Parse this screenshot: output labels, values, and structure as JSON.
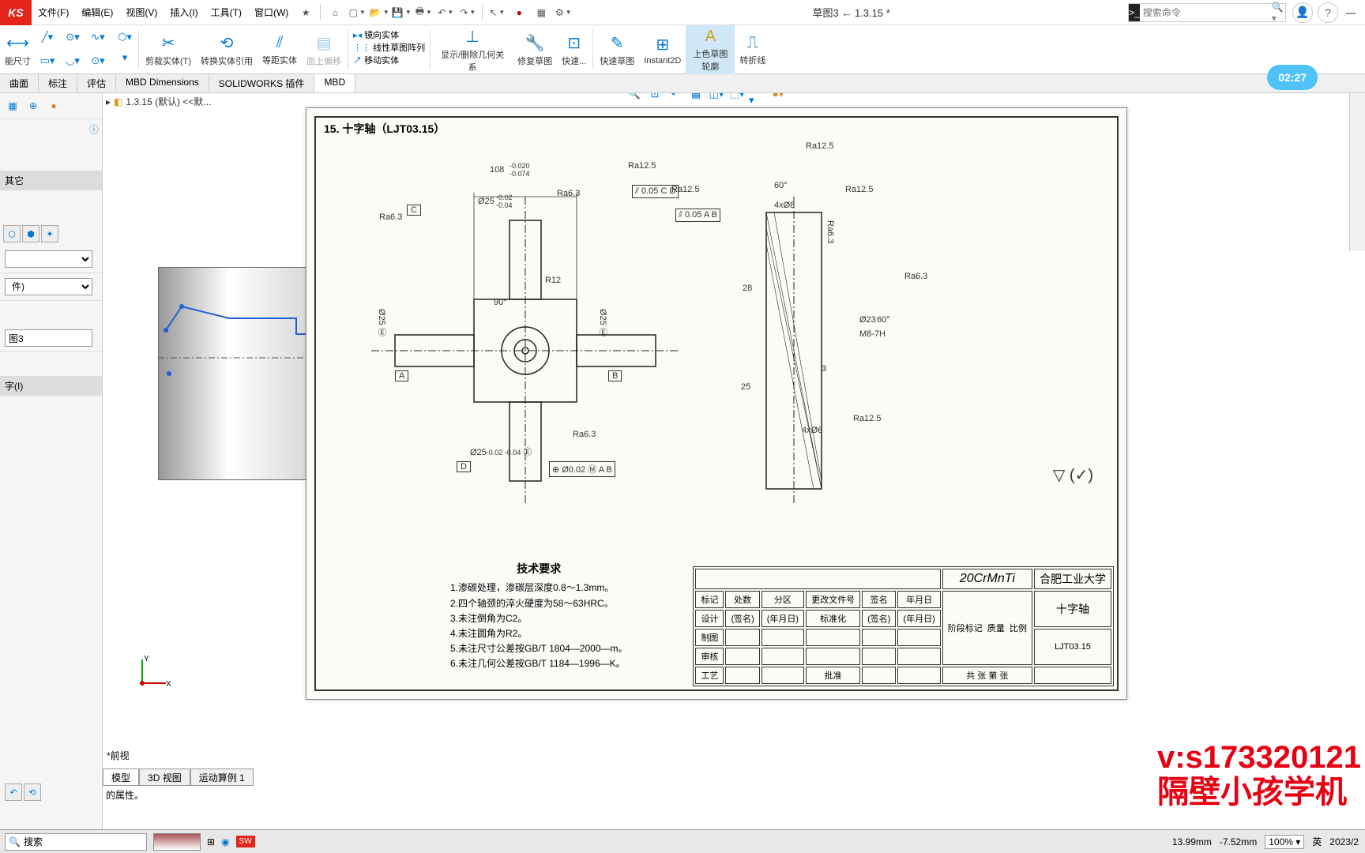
{
  "menubar": {
    "logo": "KS",
    "items": [
      "文件(F)",
      "编辑(E)",
      "视图(V)",
      "插入(I)",
      "工具(T)",
      "窗口(W)"
    ],
    "doc_title": "草图3 ← 1.3.15 *",
    "search_placeholder": "搜索命令"
  },
  "ribbon": {
    "btn1": "能尺寸",
    "trim": "剪裁实体(T)",
    "convert": "转换实体引用",
    "offset": "等距实体",
    "surface": "面上偏移",
    "mirror": "镜向实体",
    "pattern": "线性草图阵列",
    "move": "移动实体",
    "relations": "显示/删除几何关系",
    "repair": "修复草图",
    "quick1": "快速...",
    "quick2": "快速草图",
    "instant": "Instant2D",
    "shade": "上色草图轮廓",
    "snap": "转折线",
    "timer": "02:27"
  },
  "tabs": [
    "曲面",
    "标注",
    "评估",
    "MBD Dimensions",
    "SOLIDWORKS 插件",
    "MBD"
  ],
  "breadcrumb": "1.3.15 (默认) <<默...",
  "panel": {
    "section1": "其它",
    "input1": "图3",
    "section2": "字(I)",
    "dropdown1": "件)"
  },
  "view_label": "*前视",
  "drawing": {
    "title": "15. 十字轴（LJT03.15）",
    "tech_title": "技术要求",
    "tech": [
      "1.渗碳处理，渗碳层深度0.8～1.3mm。",
      "2.四个轴颈的淬火硬度为58～63HRC。",
      "3.未注倒角为C2。",
      "4.未注圆角为R2。",
      "5.未注尺寸公差按GB/T 1804—2000—m。",
      "6.未注几何公差按GB/T 1184—1996—K。"
    ],
    "dims": {
      "d108a": "108",
      "d108tol": "-0.020\n-0.074",
      "d25": "Ø25",
      "d25tol": "-0.02\n-0.04",
      "r12": "R12",
      "ang90": "90°",
      "ra63": "Ra6.3",
      "ra125": "Ra12.5",
      "fcf1": "0.05",
      "fcf2": "Ø0.02",
      "ang60": "60°",
      "d28": "28",
      "d25b": "25",
      "d3": "3",
      "dim4x08": "4xØ8",
      "dim4x06": "4xØ6",
      "d23": "Ø23",
      "m8": "M8-7H"
    },
    "material": "20CrMnTi",
    "school": "合肥工业大学",
    "part_name": "十字轴",
    "part_no": "LJT03.15",
    "tbl": {
      "标记": "标记",
      "处数": "处数",
      "分区": "分区",
      "更改": "更改文件号",
      "签名": "签名",
      "年月日": "年月日",
      "设计": "设计",
      "标准化": "标准化",
      "制图": "制图",
      "审核": "审核",
      "工艺": "工艺",
      "批准": "批准",
      "阶段": "阶段标记",
      "质量": "质量",
      "比例": "比例",
      "共": "共",
      "张": "张",
      "第": "第"
    }
  },
  "bottom_tabs": [
    "模型",
    "3D 视图",
    "运动算例 1"
  ],
  "status_msg": "的属性。",
  "status": {
    "search": "搜索",
    "coord_x": "13.99mm",
    "coord_y": "-7.52mm",
    "zoom": "100%",
    "ime": "英",
    "date": "2023/2"
  },
  "watermark": {
    "line1": "v:s173320121",
    "line2": "隔壁小孩学机"
  }
}
